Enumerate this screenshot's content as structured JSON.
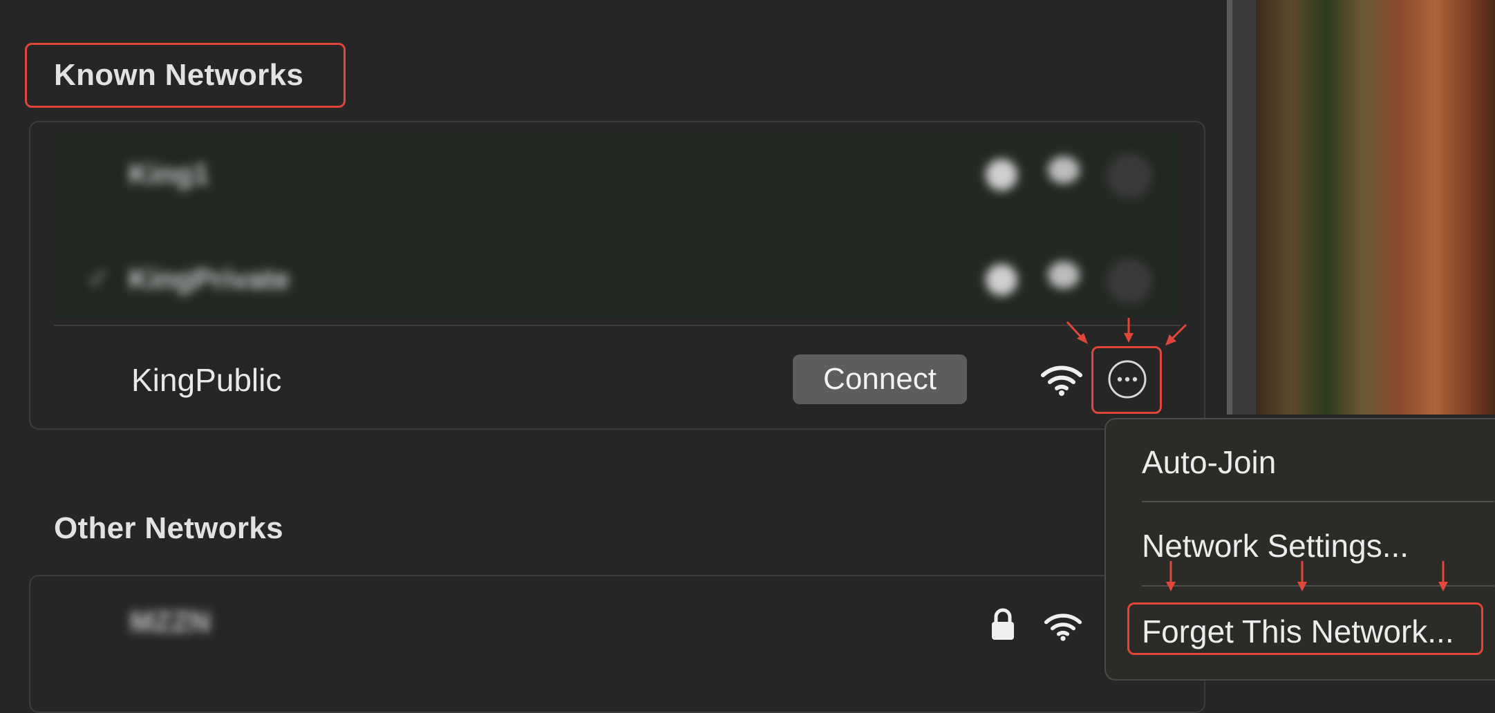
{
  "known_networks": {
    "title": "Known Networks",
    "blurred_rows": [
      {
        "name": "King1"
      },
      {
        "name": "KingPrivate"
      }
    ],
    "active_row": {
      "name": "KingPublic",
      "connect_label": "Connect",
      "wifi_icon": "wifi-icon",
      "more_icon": "ellipsis-circle-icon"
    }
  },
  "other_networks": {
    "title": "Other Networks",
    "rows": [
      {
        "name": "MZZN",
        "lock_icon": "lock-icon",
        "wifi_icon": "wifi-icon"
      }
    ]
  },
  "context_menu": {
    "items": [
      {
        "label": "Auto-Join"
      },
      {
        "label": "Network Settings..."
      },
      {
        "label": "Forget This Network..."
      }
    ]
  },
  "colors": {
    "highlight": "#e0473a",
    "background": "#262626"
  }
}
